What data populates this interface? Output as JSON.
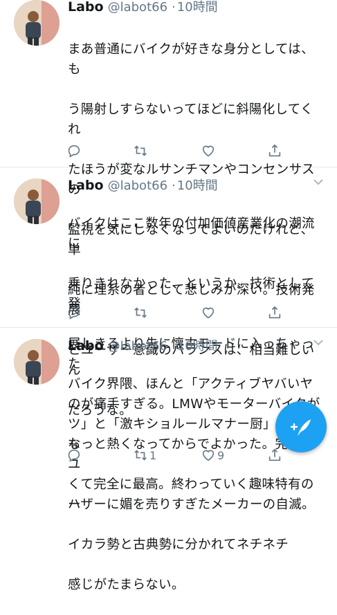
{
  "colors": {
    "accent": "#1da1f2",
    "muted": "#657786",
    "text": "#14171a",
    "divider": "#e1e8ed"
  },
  "tweets": [
    {
      "name": "Labo",
      "handle": "@labot66",
      "time": "10時間",
      "lines": [
        "まあ普通にバイクが好きな身分としては、も",
        "う陽射しすらないってほどに斜陽化してくれ",
        "たほうが変なルサンチマンやコンセンサスの",
        "監視を気にしなくなってよいのだけれど、単",
        "純に理系の者として悲しみが深い。技術発展",
        "とユーザー意識のバランスは、相当難しいん",
        "だろうな。"
      ],
      "reply_count": "",
      "retweet_count": "",
      "like_count": ""
    },
    {
      "name": "Labo",
      "handle": "@labot66",
      "time": "10時間",
      "lines": [
        "バイクはここ数年の付加価値産業化の潮流に",
        "乗りきれなかった、というか、技術として発",
        "展しきるより先に懐古モードに入っちゃった",
        "のが痛手すぎる。LMWやモーターバイクが",
        "もっと熱くなってからでよかった。完全にユ",
        "ーザーに媚を売りすぎたメーカーの自滅。"
      ],
      "reply_count": "",
      "retweet_count": "",
      "like_count": ""
    },
    {
      "name": "Labo",
      "handle": "@labot66",
      "time": "10時間",
      "lines": [
        "バイク界隈、ほんと「アクティブヤバいヤ",
        "ツ」と「激キショルールマナー厨」しかいな",
        "くて完全に最高。終わっていく趣味特有のハ",
        "イカラ勢と古典勢に分かれてネチネチ",
        "感じがたまらない。"
      ],
      "reply_count": "",
      "retweet_count": "1",
      "like_count": "9"
    }
  ],
  "icons": {
    "reply": "reply-icon",
    "retweet": "retweet-icon",
    "like": "heart-icon",
    "share": "share-icon",
    "caret": "chevron-down-icon",
    "compose": "compose-tweet-icon"
  }
}
